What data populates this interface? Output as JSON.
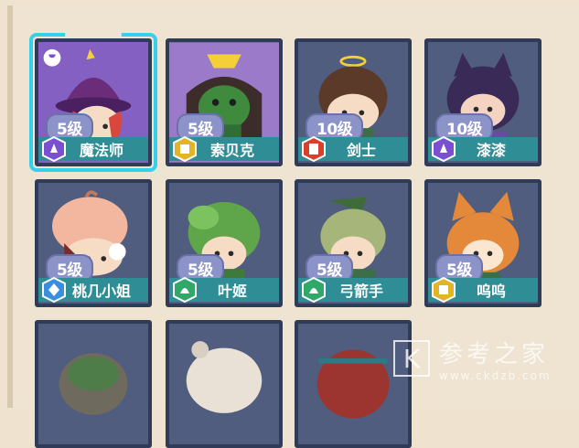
{
  "cards": [
    {
      "level": "5级",
      "name": "魔法师",
      "badge": "purple-hex-icon",
      "badge_color": "#7a4fd0",
      "selected": true
    },
    {
      "level": "5级",
      "name": "索贝克",
      "badge": "gold-hex-icon",
      "badge_color": "#e2b428"
    },
    {
      "level": "10级",
      "name": "剑士",
      "badge": "red-hex-icon",
      "badge_color": "#d8402c"
    },
    {
      "level": "10级",
      "name": "漆漆",
      "badge": "purple-hex-icon",
      "badge_color": "#7a4fd0"
    },
    {
      "level": "5级",
      "name": "桃几小姐",
      "badge": "blue-hex-icon",
      "badge_color": "#3a8ee0"
    },
    {
      "level": "5级",
      "name": "叶姬",
      "badge": "green-hex-icon",
      "badge_color": "#2fa86a"
    },
    {
      "level": "5级",
      "name": "弓箭手",
      "badge": "green-hex-icon",
      "badge_color": "#2fa86a"
    },
    {
      "level": "5级",
      "name": "呜呜",
      "badge": "gold-hex-icon",
      "badge_color": "#e2b428"
    }
  ],
  "watermark": {
    "title": "参考之家",
    "url": "www.ckdzb.com",
    "glyph": "K"
  }
}
